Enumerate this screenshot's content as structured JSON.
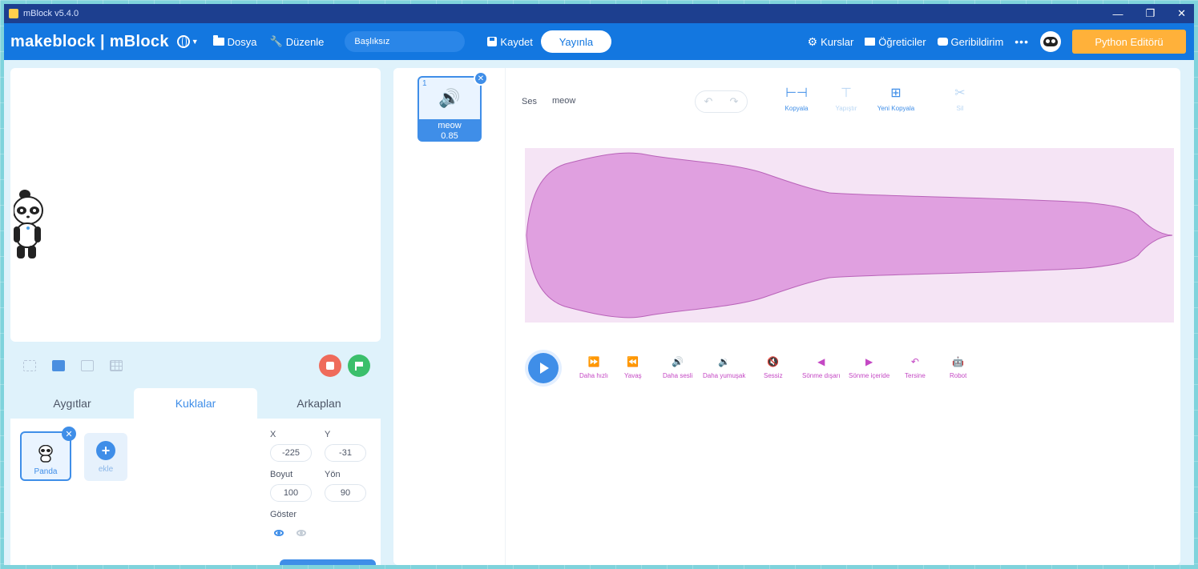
{
  "titlebar": {
    "title": "mBlock v5.4.0",
    "minimize": "—",
    "restore": "❐",
    "close": "✕"
  },
  "menubar": {
    "brand": "makeblock | mBlock",
    "file": "Dosya",
    "edit": "Düzenle",
    "project_name": "Başlıksız",
    "save": "Kaydet",
    "publish": "Yayınla",
    "courses": "Kurslar",
    "tutorials": "Öğreticiler",
    "feedback": "Geribildirim",
    "more": "•••",
    "python_editor": "Python Editörü"
  },
  "stage_controls": {
    "stop_icon": "stop-icon",
    "go_icon": "green-flag-icon"
  },
  "tabs": [
    {
      "label": "Aygıtlar"
    },
    {
      "label": "Kuklalar",
      "active": true
    },
    {
      "label": "Arkaplan"
    }
  ],
  "sprites": {
    "items": [
      {
        "name": "Panda"
      }
    ],
    "add_label": "ekle"
  },
  "props": {
    "x_label": "X",
    "y_label": "Y",
    "x": "-225",
    "y": "-31",
    "size_label": "Boyut",
    "direction_label": "Yön",
    "size": "100",
    "direction": "90",
    "show_label": "Göster"
  },
  "sound_editor": {
    "list": [
      {
        "index": "1",
        "name": "meow",
        "duration": "0.85"
      }
    ],
    "sound_label": "Ses",
    "sound_name": "meow",
    "undo": "↶",
    "redo": "↷",
    "tools": [
      {
        "label": "Kopyala",
        "glyph": "⊢⊣",
        "enabled": true
      },
      {
        "label": "Yapıştır",
        "glyph": "⊤",
        "enabled": false
      },
      {
        "label": "Yeni Kopyala",
        "glyph": "⊞",
        "enabled": true
      },
      {
        "label": "Sil",
        "glyph": "✂",
        "enabled": false
      }
    ],
    "effects": [
      {
        "label": "Daha hızlı",
        "glyph": "⏩"
      },
      {
        "label": "Yavaş",
        "glyph": "⏪"
      },
      {
        "label": "Daha sesli",
        "glyph": "🔊"
      },
      {
        "label": "Daha yumuşak",
        "glyph": "🔉"
      },
      {
        "label": "Sessiz",
        "glyph": "🔇"
      },
      {
        "label": "Sönme dışarı",
        "glyph": "◀"
      },
      {
        "label": "Sönme içeride",
        "glyph": "▶"
      },
      {
        "label": "Tersine",
        "glyph": "↶"
      },
      {
        "label": "Robot",
        "glyph": "🤖"
      }
    ],
    "waveform_color": "#e0a0e0",
    "waveform_stroke": "#b862b8"
  }
}
